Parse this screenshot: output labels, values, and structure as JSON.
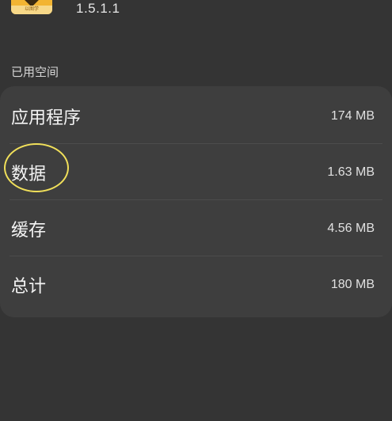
{
  "app": {
    "version": "1.5.1.1",
    "icon_caption": "以图学"
  },
  "section": {
    "title": "已用空间"
  },
  "storage": {
    "rows": [
      {
        "label": "应用程序",
        "value": "174 MB"
      },
      {
        "label": "数据",
        "value": "1.63 MB"
      },
      {
        "label": "缓存",
        "value": "4.56 MB"
      },
      {
        "label": "总计",
        "value": "180 MB"
      }
    ]
  },
  "colors": {
    "background": "#343434",
    "card": "#3e3e3e",
    "annotation": "#f1e05a",
    "app_icon": "#f2b432"
  }
}
